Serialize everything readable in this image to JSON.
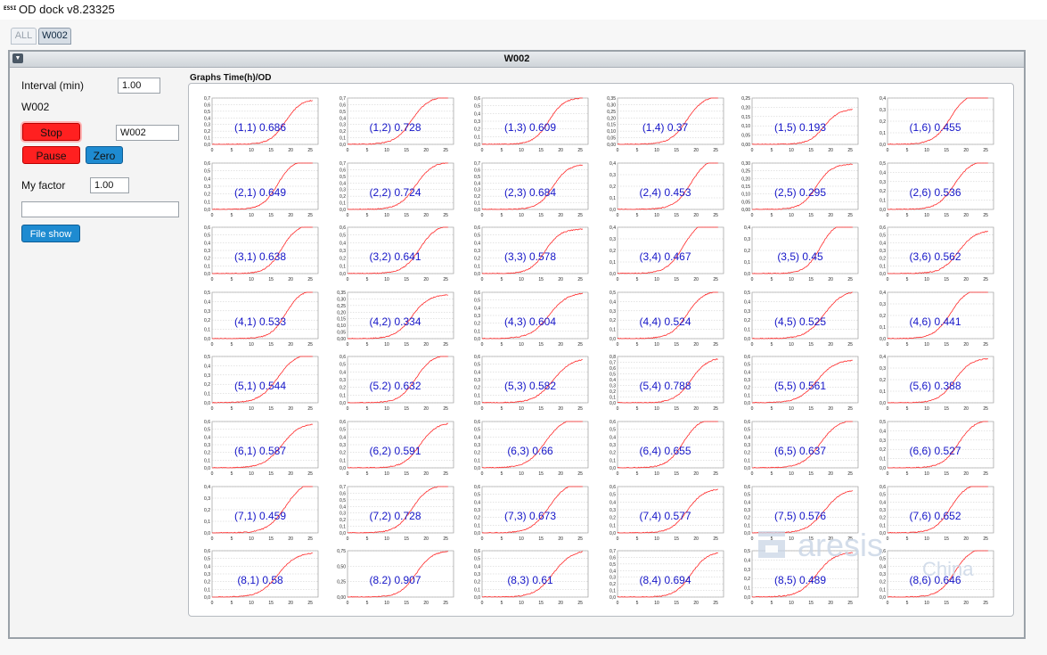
{
  "app": {
    "logo": "ESSI",
    "title": "OD dock v8.23325"
  },
  "tabs": [
    {
      "label": "ALL"
    },
    {
      "label": "W002"
    }
  ],
  "panel": {
    "title": "W002"
  },
  "controls": {
    "interval_label": "Interval (min)",
    "interval_value": "1.00",
    "name_label": "W002",
    "name_value": "W002",
    "stop_label": "Stop",
    "pause_label": "Pause",
    "zero_label": "Zero",
    "factor_label": "My factor",
    "factor_value": "1.00",
    "status_value": "",
    "file_show_label": "File show"
  },
  "graphs": {
    "title": "Graphs Time(h)/OD",
    "x_ticks": [
      "0",
      "5",
      "10",
      "15",
      "20",
      "25"
    ],
    "colors": {
      "curve": "#ff2a2a",
      "label": "#1515c8",
      "grid": "#c9c9c9"
    },
    "cells": [
      {
        "label": "(1,1) 0.686",
        "od": 0.686,
        "yticks": [
          "0,7",
          "0,6",
          "0,5",
          "0,4",
          "0,3",
          "0,2",
          "0,1",
          "0,0"
        ],
        "ymax": 0.7
      },
      {
        "label": "(1,2) 0.728",
        "od": 0.728,
        "yticks": [
          "0,7",
          "0,6",
          "0,5",
          "0,4",
          "0,3",
          "0,2",
          "0,1",
          "0,0"
        ],
        "ymax": 0.7
      },
      {
        "label": "(1,3) 0.609",
        "od": 0.609,
        "yticks": [
          "0,6",
          "0,5",
          "0,4",
          "0,3",
          "0,2",
          "0,1",
          "0,0"
        ],
        "ymax": 0.6
      },
      {
        "label": "(1,4) 0.37",
        "od": 0.37,
        "yticks": [
          "0,35",
          "0,30",
          "0,25",
          "0,20",
          "0,15",
          "0,10",
          "0,05",
          "0,00"
        ],
        "ymax": 0.35
      },
      {
        "label": "(1,5) 0.193",
        "od": 0.193,
        "yticks": [
          "0,25",
          "0,20",
          "0,15",
          "0,10",
          "0,05",
          "0,00"
        ],
        "ymax": 0.25
      },
      {
        "label": "(1,6) 0.455",
        "od": 0.455,
        "yticks": [
          "0,4",
          "0,3",
          "0,2",
          "0,1",
          "0,0"
        ],
        "ymax": 0.4
      },
      {
        "label": "(2,1) 0.649",
        "od": 0.649,
        "yticks": [
          "0,6",
          "0,5",
          "0,4",
          "0,3",
          "0,2",
          "0,1",
          "0,0"
        ],
        "ymax": 0.6
      },
      {
        "label": "(2,2) 0.724",
        "od": 0.724,
        "yticks": [
          "0,7",
          "0,6",
          "0,5",
          "0,4",
          "0,3",
          "0,2",
          "0,1",
          "0,0"
        ],
        "ymax": 0.7
      },
      {
        "label": "(2,3) 0.684",
        "od": 0.684,
        "yticks": [
          "0,7",
          "0,6",
          "0,5",
          "0,4",
          "0,3",
          "0,2",
          "0,1",
          "0,0"
        ],
        "ymax": 0.7
      },
      {
        "label": "(2,4) 0.453",
        "od": 0.453,
        "yticks": [
          "0,4",
          "0,3",
          "0,2",
          "0,1",
          "0,0"
        ],
        "ymax": 0.4
      },
      {
        "label": "(2,5) 0.295",
        "od": 0.295,
        "yticks": [
          "0,30",
          "0,25",
          "0,20",
          "0,15",
          "0,10",
          "0,05",
          "0,00"
        ],
        "ymax": 0.3
      },
      {
        "label": "(2,6) 0.536",
        "od": 0.536,
        "yticks": [
          "0,5",
          "0,4",
          "0,3",
          "0,2",
          "0,1",
          "0,0"
        ],
        "ymax": 0.5
      },
      {
        "label": "(3,1) 0.638",
        "od": 0.638,
        "yticks": [
          "0,6",
          "0,5",
          "0,4",
          "0,3",
          "0,2",
          "0,1",
          "0,0"
        ],
        "ymax": 0.6
      },
      {
        "label": "(3,2) 0.641",
        "od": 0.641,
        "yticks": [
          "0,6",
          "0,5",
          "0,4",
          "0,3",
          "0,2",
          "0,1",
          "0,0"
        ],
        "ymax": 0.6
      },
      {
        "label": "(3,3) 0.578",
        "od": 0.578,
        "yticks": [
          "0,6",
          "0,5",
          "0,4",
          "0,3",
          "0,2",
          "0,1",
          "0,0"
        ],
        "ymax": 0.6
      },
      {
        "label": "(3,4) 0.467",
        "od": 0.467,
        "yticks": [
          "0,4",
          "0,3",
          "0,2",
          "0,1",
          "0,0"
        ],
        "ymax": 0.4
      },
      {
        "label": "(3,5) 0.45",
        "od": 0.45,
        "yticks": [
          "0,4",
          "0,3",
          "0,2",
          "0,1",
          "0,0"
        ],
        "ymax": 0.4
      },
      {
        "label": "(3,6) 0.562",
        "od": 0.562,
        "yticks": [
          "0,6",
          "0,5",
          "0,4",
          "0,3",
          "0,2",
          "0,1",
          "0,0"
        ],
        "ymax": 0.6
      },
      {
        "label": "(4,1) 0.533",
        "od": 0.533,
        "yticks": [
          "0,5",
          "0,4",
          "0,3",
          "0,2",
          "0,1",
          "0,0"
        ],
        "ymax": 0.5
      },
      {
        "label": "(4,2) 0.334",
        "od": 0.334,
        "yticks": [
          "0,35",
          "0,30",
          "0,25",
          "0,20",
          "0,15",
          "0,10",
          "0,05",
          "0,00"
        ],
        "ymax": 0.35
      },
      {
        "label": "(4,3) 0.604",
        "od": 0.604,
        "yticks": [
          "0,6",
          "0,5",
          "0,4",
          "0,3",
          "0,2",
          "0,1",
          "0,0"
        ],
        "ymax": 0.6
      },
      {
        "label": "(4,4) 0.524",
        "od": 0.524,
        "yticks": [
          "0,5",
          "0,4",
          "0,3",
          "0,2",
          "0,1",
          "0,0"
        ],
        "ymax": 0.5
      },
      {
        "label": "(4,5) 0.525",
        "od": 0.525,
        "yticks": [
          "0,5",
          "0,4",
          "0,3",
          "0,2",
          "0,1",
          "0,0"
        ],
        "ymax": 0.5
      },
      {
        "label": "(4,6) 0.441",
        "od": 0.441,
        "yticks": [
          "0,4",
          "0,3",
          "0,2",
          "0,1",
          "0,0"
        ],
        "ymax": 0.4
      },
      {
        "label": "(5,1) 0.544",
        "od": 0.544,
        "yticks": [
          "0,5",
          "0,4",
          "0,3",
          "0,2",
          "0,1",
          "0,0"
        ],
        "ymax": 0.5
      },
      {
        "label": "(5.2) 0.632",
        "od": 0.632,
        "yticks": [
          "0,6",
          "0,5",
          "0,4",
          "0,3",
          "0,2",
          "0,1",
          "0,0"
        ],
        "ymax": 0.6
      },
      {
        "label": "(5,3) 0.582",
        "od": 0.582,
        "yticks": [
          "0,6",
          "0,5",
          "0,4",
          "0,3",
          "0,2",
          "0,1",
          "0,0"
        ],
        "ymax": 0.6
      },
      {
        "label": "(5,4) 0.788",
        "od": 0.788,
        "yticks": [
          "0,8",
          "0,7",
          "0,6",
          "0,5",
          "0,4",
          "0,3",
          "0,2",
          "0,1",
          "0,0"
        ],
        "ymax": 0.8
      },
      {
        "label": "(5,5) 0.561",
        "od": 0.561,
        "yticks": [
          "0,6",
          "0,5",
          "0,4",
          "0,3",
          "0,2",
          "0,1",
          "0,0"
        ],
        "ymax": 0.6
      },
      {
        "label": "(5,6) 0.388",
        "od": 0.388,
        "yticks": [
          "0,4",
          "0,3",
          "0,2",
          "0,1",
          "0,0"
        ],
        "ymax": 0.4
      },
      {
        "label": "(6,1) 0.587",
        "od": 0.587,
        "yticks": [
          "0,6",
          "0,5",
          "0,4",
          "0,3",
          "0,2",
          "0,1",
          "0,0"
        ],
        "ymax": 0.6
      },
      {
        "label": "(6,2) 0.591",
        "od": 0.591,
        "yticks": [
          "0,6",
          "0,5",
          "0,4",
          "0,3",
          "0,2",
          "0,1",
          "0,0"
        ],
        "ymax": 0.6
      },
      {
        "label": "(6,3) 0.66",
        "od": 0.66,
        "yticks": [
          "0,6",
          "0,5",
          "0,4",
          "0,3",
          "0,2",
          "0,1",
          "0,0"
        ],
        "ymax": 0.6
      },
      {
        "label": "(6,4) 0.655",
        "od": 0.655,
        "yticks": [
          "0,6",
          "0,5",
          "0,4",
          "0,3",
          "0,2",
          "0,1",
          "0,0"
        ],
        "ymax": 0.6
      },
      {
        "label": "(6,5) 0.637",
        "od": 0.637,
        "yticks": [
          "0,6",
          "0,5",
          "0,4",
          "0,3",
          "0,2",
          "0,1",
          "0,0"
        ],
        "ymax": 0.6
      },
      {
        "label": "(6,6) 0.527",
        "od": 0.527,
        "yticks": [
          "0,5",
          "0,4",
          "0,3",
          "0,2",
          "0,1",
          "0,0"
        ],
        "ymax": 0.5
      },
      {
        "label": "(7,1) 0.459",
        "od": 0.459,
        "yticks": [
          "0,4",
          "0,3",
          "0,2",
          "0,1",
          "0,0"
        ],
        "ymax": 0.4
      },
      {
        "label": "(7,2) 0.728",
        "od": 0.728,
        "yticks": [
          "0,7",
          "0,6",
          "0,5",
          "0,4",
          "0,3",
          "0,2",
          "0,1",
          "0,0"
        ],
        "ymax": 0.7
      },
      {
        "label": "(7,3) 0.673",
        "od": 0.673,
        "yticks": [
          "0,6",
          "0,5",
          "0,4",
          "0,3",
          "0,2",
          "0,1",
          "0,0"
        ],
        "ymax": 0.6
      },
      {
        "label": "(7,4) 0.577",
        "od": 0.577,
        "yticks": [
          "0,6",
          "0,5",
          "0,4",
          "0,3",
          "0,2",
          "0,1",
          "0,0"
        ],
        "ymax": 0.6
      },
      {
        "label": "(7,5) 0.576",
        "od": 0.576,
        "yticks": [
          "0,6",
          "0,5",
          "0,4",
          "0,3",
          "0,2",
          "0,1",
          "0,0"
        ],
        "ymax": 0.6
      },
      {
        "label": "(7,6) 0.652",
        "od": 0.652,
        "yticks": [
          "0,6",
          "0,5",
          "0,4",
          "0,3",
          "0,2",
          "0,1",
          "0,0"
        ],
        "ymax": 0.6
      },
      {
        "label": "(8,1) 0.58",
        "od": 0.58,
        "yticks": [
          "0,6",
          "0,5",
          "0,4",
          "0,3",
          "0,2",
          "0,1",
          "0,0"
        ],
        "ymax": 0.6
      },
      {
        "label": "(8.2) 0.907",
        "od": 0.907,
        "yticks": [
          "0,75",
          "0,50",
          "0,25",
          "0,00"
        ],
        "ymax": 0.9
      },
      {
        "label": "(8,3) 0.61",
        "od": 0.61,
        "yticks": [
          "0,6",
          "0,5",
          "0,4",
          "0,3",
          "0,2",
          "0,1",
          "0,0"
        ],
        "ymax": 0.6
      },
      {
        "label": "(8,4) 0.694",
        "od": 0.694,
        "yticks": [
          "0,7",
          "0,6",
          "0,5",
          "0,4",
          "0,3",
          "0,2",
          "0,1",
          "0,0"
        ],
        "ymax": 0.7
      },
      {
        "label": "(8,5) 0.489",
        "od": 0.489,
        "yticks": [
          "0,5",
          "0,4",
          "0,3",
          "0,2",
          "0,1",
          "0,0"
        ],
        "ymax": 0.5
      },
      {
        "label": "(8,6) 0.646",
        "od": 0.646,
        "yticks": [
          "0,6",
          "0,5",
          "0,4",
          "0,3",
          "0,2",
          "0,1",
          "0,0"
        ],
        "ymax": 0.6
      }
    ]
  },
  "watermark": {
    "text_top": "aresis",
    "text_bottom": "China"
  }
}
